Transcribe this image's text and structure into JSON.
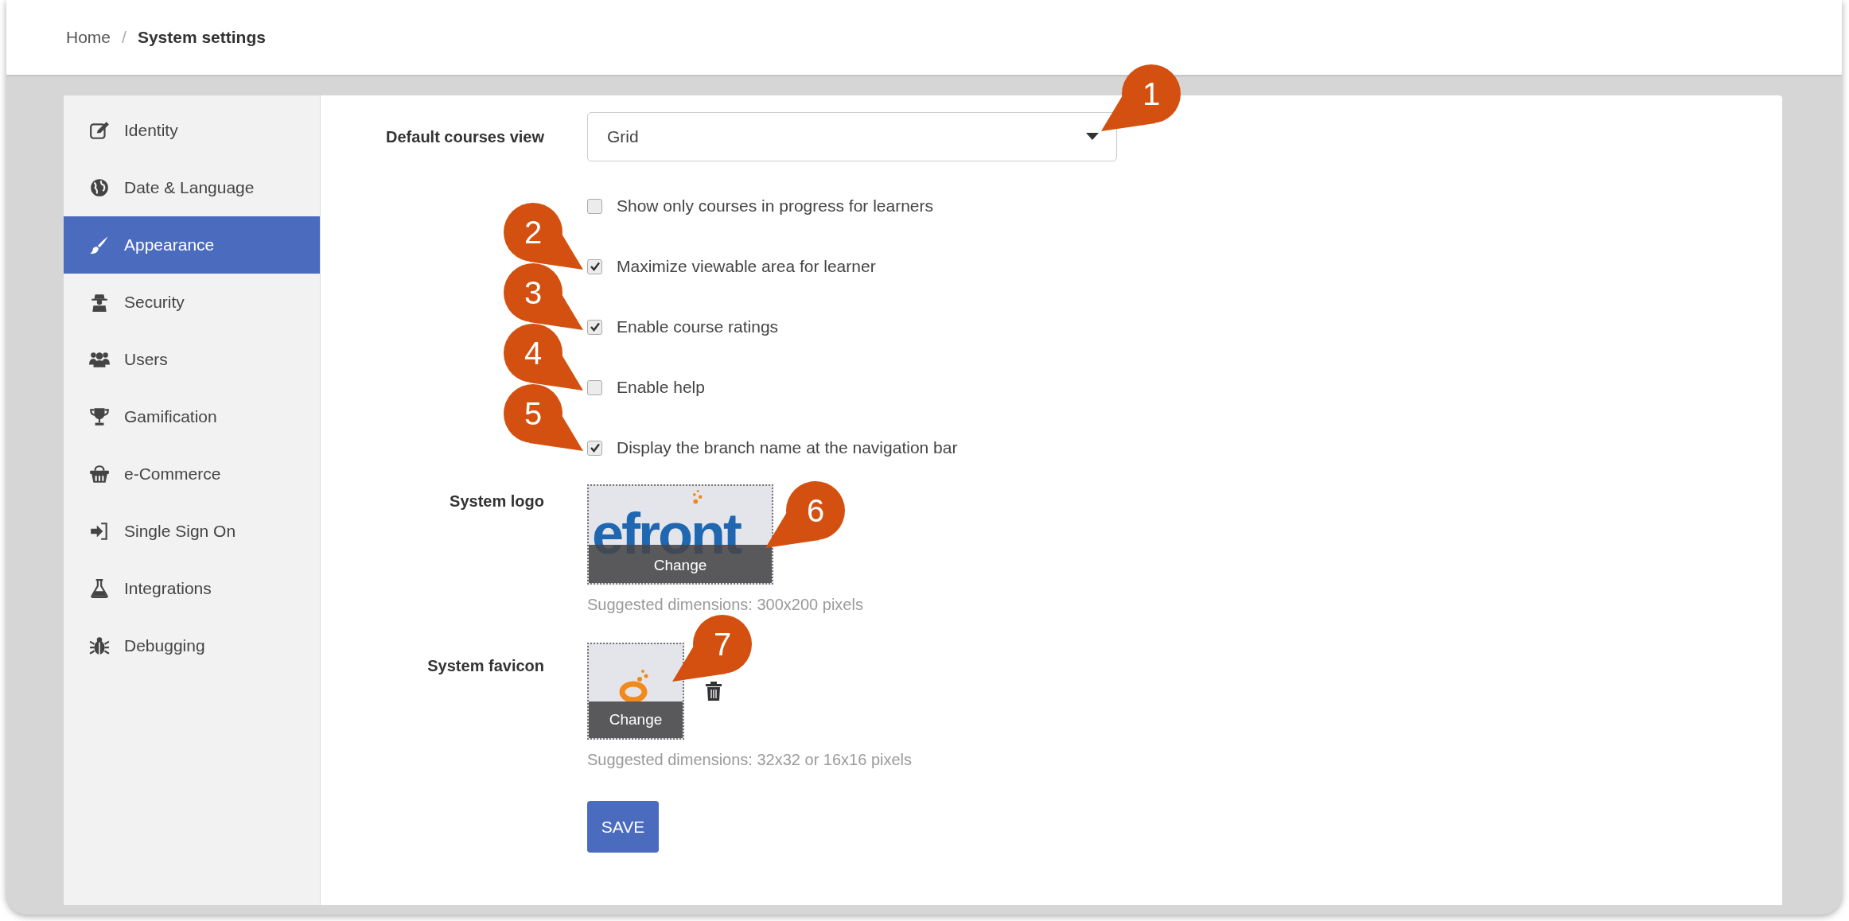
{
  "breadcrumb": [
    {
      "label": "Home",
      "current": false
    },
    {
      "separator": "/",
      "label": "System settings",
      "current": true
    }
  ],
  "sidebar": {
    "items": [
      {
        "label": "Identity",
        "selected": false
      },
      {
        "label": "Date & Language",
        "selected": false
      },
      {
        "label": "Appearance",
        "selected": true
      },
      {
        "label": "Security",
        "selected": false
      },
      {
        "label": "Users",
        "selected": false
      },
      {
        "label": "Gamification",
        "selected": false
      },
      {
        "label": "e-Commerce",
        "selected": false
      },
      {
        "label": "Single Sign On",
        "selected": false
      },
      {
        "label": "Integrations",
        "selected": false
      },
      {
        "label": "Debugging",
        "selected": false
      }
    ]
  },
  "form": {
    "default_view": {
      "label": "Default courses view",
      "value": "Grid",
      "callout": "1"
    },
    "options": [
      {
        "label": "Show only courses in progress for learners",
        "checked": false
      },
      {
        "label": "Maximize viewable area for learner",
        "checked": true,
        "callout": "2"
      },
      {
        "label": "Enable course ratings",
        "checked": true,
        "callout": "3"
      },
      {
        "label": "Enable help",
        "checked": false,
        "callout": "4"
      },
      {
        "label": "Display the branch name at the navigation bar",
        "checked": true,
        "callout": "5"
      }
    ],
    "system_logo": {
      "label": "System logo",
      "logo_text": "efront",
      "change": "Change",
      "hint": "Suggested dimensions: 300x200 pixels",
      "callout": "6"
    },
    "system_favicon": {
      "label": "System favicon",
      "change": "Change",
      "hint": "Suggested dimensions: 32x32 or 16x16 pixels",
      "callout": "7"
    },
    "save": "SAVE"
  }
}
